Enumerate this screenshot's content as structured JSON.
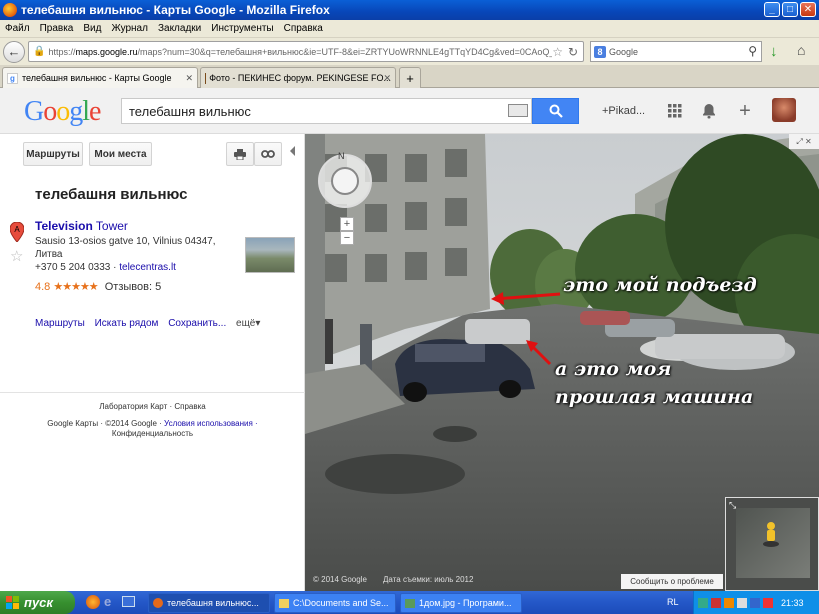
{
  "window": {
    "title": "телебашня вильнюс - Карты Google - Mozilla Firefox"
  },
  "menu": [
    "Файл",
    "Правка",
    "Вид",
    "Журнал",
    "Закладки",
    "Инструменты",
    "Справка"
  ],
  "url": {
    "prefix": "https://",
    "domain": "maps.google.ru",
    "rest": "/maps?num=30&q=телебашня+вильнюс&ie=UTF-8&ei=ZRTYUoWRNNLE4gTTqYD4Cg&ved=0CAoQ_A"
  },
  "browser_search": {
    "placeholder": "Google"
  },
  "tabs": [
    {
      "label": "телебашня вильнюс - Карты Google",
      "active": true
    },
    {
      "label": "Фото - ПЕКИНЕС форум. PEKINGESE FO...",
      "active": false
    }
  ],
  "google": {
    "logo": "Google",
    "query": "телебашня вильнюс",
    "user": "+Pikad..."
  },
  "panel": {
    "btn_routes": "Маршруты",
    "btn_places": "Мои места",
    "title": "телебашня вильнюс",
    "place_name_a": "Television",
    "place_name_b": "Tower",
    "address": "Sausio 13-osios gatve 10, Vilnius 04347, Литва",
    "phone": "+370 5 204 0333",
    "site": "telecentras.lt",
    "rating": "4.8",
    "stars": "★★★★★",
    "reviews": "Отзывов: 5",
    "links": [
      "Маршруты",
      "Искать рядом",
      "Сохранить...",
      "ещё▾"
    ],
    "footer1": "Лаборатория Карт · Справка",
    "footer2_a": "Google Карты · ©2014 Google · ",
    "footer2_b": "Условия использования ·",
    "footer3": "Конфиденциальность"
  },
  "streetview": {
    "caption1": "это мой подъезд",
    "caption2a": "а это моя",
    "caption2b": "прошлая машина",
    "copyright": "© 2014 Google",
    "date": "Дата съемки: июль 2012",
    "report": "Сообщить о проблеме"
  },
  "taskbar": {
    "start": "пуск",
    "items": [
      "телебашня вильнюс...",
      "C:\\Documents and Se...",
      "1дом.jpg - Програми..."
    ],
    "lang": "RL",
    "time": "21:33"
  }
}
